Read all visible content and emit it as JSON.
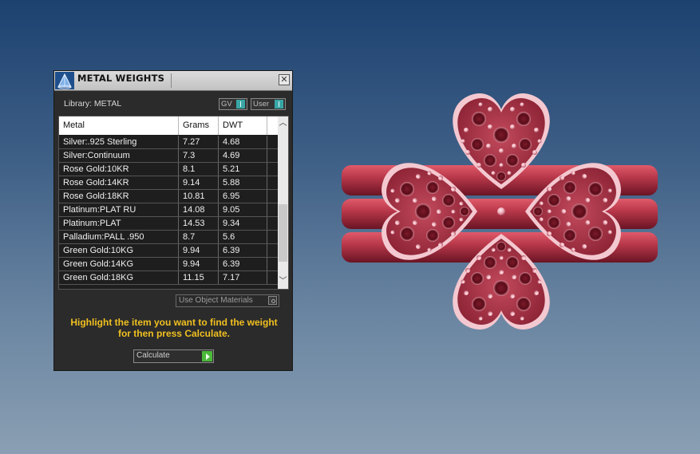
{
  "window": {
    "title": "METAL WEIGHTS",
    "close_label": "✕"
  },
  "library": {
    "label": "Library: METAL",
    "toggle_gv": "GV",
    "toggle_user": "User"
  },
  "table": {
    "headers": [
      "Metal",
      "Grams",
      "DWT"
    ],
    "rows": [
      {
        "metal": "Silver:.925 Sterling",
        "grams": "7.27",
        "dwt": "4.68"
      },
      {
        "metal": "Silver:Continuum",
        "grams": "7.3",
        "dwt": "4.69"
      },
      {
        "metal": "Rose Gold:10KR",
        "grams": "8.1",
        "dwt": "5.21"
      },
      {
        "metal": "Rose Gold:14KR",
        "grams": "9.14",
        "dwt": "5.88"
      },
      {
        "metal": "Rose Gold:18KR",
        "grams": "10.81",
        "dwt": "6.95"
      },
      {
        "metal": "Platinum:PLAT RU",
        "grams": "14.08",
        "dwt": "9.05"
      },
      {
        "metal": "Platinum:PLAT",
        "grams": "14.53",
        "dwt": "9.34"
      },
      {
        "metal": "Palladium:PALL .950",
        "grams": "8.7",
        "dwt": "5.6"
      },
      {
        "metal": "Green Gold:10KG",
        "grams": "9.94",
        "dwt": "6.39"
      },
      {
        "metal": "Green Gold:14KG",
        "grams": "9.94",
        "dwt": "6.39"
      },
      {
        "metal": "Green Gold:18KG",
        "grams": "11.15",
        "dwt": "7.17"
      }
    ]
  },
  "options": {
    "use_object_materials": "Use Object Materials"
  },
  "instruction": {
    "line1": "Highlight the item you want to find the weight",
    "line2": "for then press Calculate."
  },
  "calculate": {
    "label": "Calculate"
  },
  "colors": {
    "instruction": "#f0c020",
    "toggle_accent": "#3aa6a6",
    "calculate_accent": "#4cb83a",
    "ring_metal": "#b8384a"
  }
}
